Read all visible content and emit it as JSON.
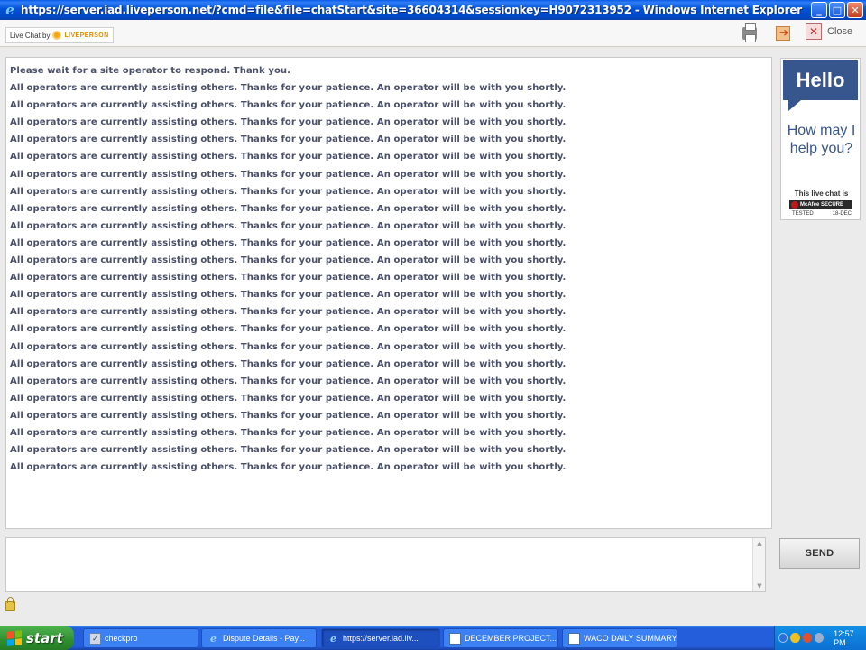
{
  "window": {
    "title": "https://server.iad.liveperson.net/?cmd=file&file=chatStart&site=36604314&sessionkey=H9072313952 - Windows Internet Explorer",
    "minimize": "_",
    "maximize": "□",
    "close": "✕"
  },
  "toolbar": {
    "brand_prefix": "Live Chat by",
    "brand_name": "LIVEPERSON",
    "close_label": "Close"
  },
  "transcript": {
    "messages": [
      "Please wait for a site operator to respond. Thank you.",
      "All operators are currently assisting others. Thanks for your patience. An operator will be with you shortly.",
      "All operators are currently assisting others. Thanks for your patience. An operator will be with you shortly.",
      "All operators are currently assisting others. Thanks for your patience. An operator will be with you shortly.",
      "All operators are currently assisting others. Thanks for your patience. An operator will be with you shortly.",
      "All operators are currently assisting others. Thanks for your patience. An operator will be with you shortly.",
      "All operators are currently assisting others. Thanks for your patience. An operator will be with you shortly.",
      "All operators are currently assisting others. Thanks for your patience. An operator will be with you shortly.",
      "All operators are currently assisting others. Thanks for your patience. An operator will be with you shortly.",
      "All operators are currently assisting others. Thanks for your patience. An operator will be with you shortly.",
      "All operators are currently assisting others. Thanks for your patience. An operator will be with you shortly.",
      "All operators are currently assisting others. Thanks for your patience. An operator will be with you shortly.",
      "All operators are currently assisting others. Thanks for your patience. An operator will be with you shortly.",
      "All operators are currently assisting others. Thanks for your patience. An operator will be with you shortly.",
      "All operators are currently assisting others. Thanks for your patience. An operator will be with you shortly.",
      "All operators are currently assisting others. Thanks for your patience. An operator will be with you shortly.",
      "All operators are currently assisting others. Thanks for your patience. An operator will be with you shortly.",
      "All operators are currently assisting others. Thanks for your patience. An operator will be with you shortly.",
      "All operators are currently assisting others. Thanks for your patience. An operator will be with you shortly.",
      "All operators are currently assisting others. Thanks for your patience. An operator will be with you shortly.",
      "All operators are currently assisting others. Thanks for your patience. An operator will be with you shortly.",
      "All operators are currently assisting others. Thanks for your patience. An operator will be with you shortly.",
      "All operators are currently assisting others. Thanks for your patience. An operator will be with you shortly.",
      "All operators are currently assisting others. Thanks for your patience. An operator will be with you shortly."
    ]
  },
  "ad": {
    "headline": "Hello",
    "subtext": "How may I help you?",
    "secure_text": "This live chat is",
    "badge_text": "McAfee SECURE",
    "tested_label": "TESTED",
    "tested_date": "18-DEC"
  },
  "input": {
    "value": "",
    "send_label": "SEND"
  },
  "taskbar": {
    "start_label": "start",
    "tasks": [
      {
        "label": "checkpro",
        "icon": "app-icon"
      },
      {
        "label": "Dispute Details - Pay...",
        "icon": "ie-icon"
      },
      {
        "label": "https://server.iad.liv...",
        "icon": "ie-icon"
      },
      {
        "label": "DECEMBER PROJECT...",
        "icon": "doc-icon"
      },
      {
        "label": "WACO DAILY SUMMARY",
        "icon": "doc-icon"
      }
    ],
    "clock": "12:57 PM"
  },
  "colors": {
    "message_text": "#4a4f6a",
    "ad_blue": "#37568e",
    "titlebar_blue": "#0052d6",
    "start_green": "#2e8f2e"
  }
}
